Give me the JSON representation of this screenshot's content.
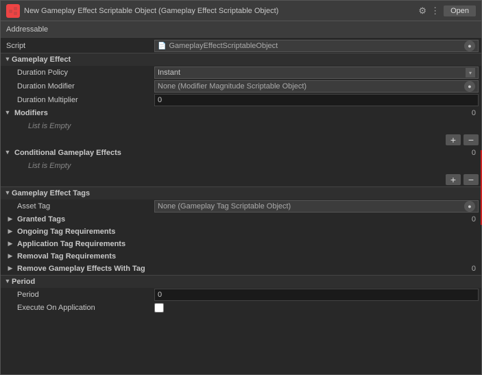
{
  "window": {
    "title": "New Gameplay Effect Scriptable Object (Gameplay Effect Scriptable Object)",
    "open_button": "Open",
    "toolbar_item": "Addressable"
  },
  "script_section": {
    "label": "Script",
    "value": "GameplayEffectScriptableObject"
  },
  "gameplay_effect": {
    "section_label": "Gameplay Effect",
    "duration_policy": {
      "label": "Duration Policy",
      "value": "Instant"
    },
    "duration_modifier": {
      "label": "Duration Modifier",
      "value": "None (Modifier Magnitude Scriptable Object)"
    },
    "duration_multiplier": {
      "label": "Duration Multiplier",
      "value": "0"
    },
    "modifiers": {
      "label": "Modifiers",
      "count": "0",
      "list_empty": "List is Empty"
    },
    "conditional_effects": {
      "label": "Conditional Gameplay Effects",
      "count": "0",
      "list_empty": "List is Empty"
    }
  },
  "gameplay_effect_tags": {
    "section_label": "Gameplay Effect Tags",
    "asset_tag": {
      "label": "Asset Tag",
      "value": "None (Gameplay Tag Scriptable Object)"
    },
    "granted_tags": {
      "label": "Granted Tags",
      "count": "0"
    },
    "ongoing_tag_requirements": {
      "label": "Ongoing Tag Requirements"
    },
    "application_tag_requirements": {
      "label": "Application Tag Requirements"
    },
    "removal_tag_requirements": {
      "label": "Removal Tag Requirements"
    },
    "remove_gameplay_effects_with_tag": {
      "label": "Remove Gameplay Effects With Tag",
      "count": "0"
    }
  },
  "period": {
    "section_label": "Period",
    "period_value": {
      "label": "Period",
      "value": "0"
    },
    "execute_on_application": {
      "label": "Execute On Application"
    }
  },
  "icons": {
    "triangle_open": "▼",
    "triangle_closed": "▶",
    "settings": "⚙",
    "more": "⋮",
    "plus": "+",
    "minus": "−",
    "circle_dot": "●",
    "arrow_down": "▾"
  }
}
